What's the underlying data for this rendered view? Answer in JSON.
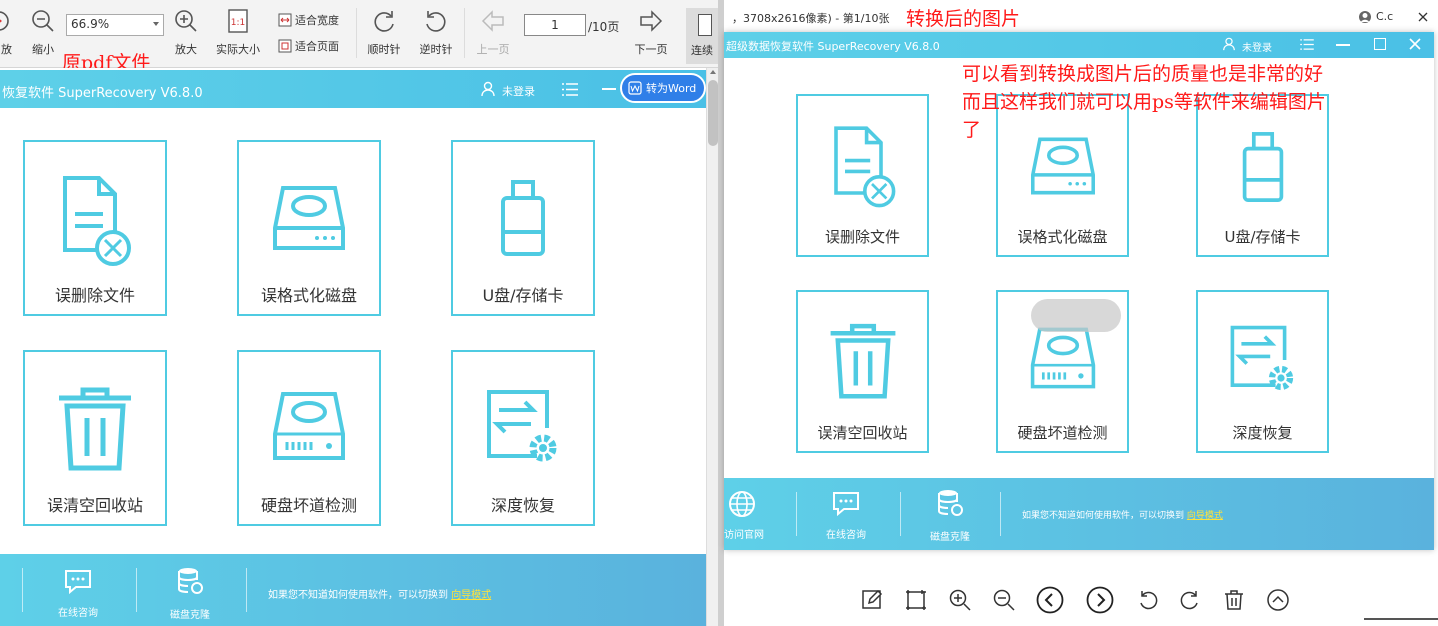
{
  "left_toolbar": {
    "zoom_value": "66.9%",
    "page_input": "1",
    "page_total": "/10页",
    "buttons": {
      "enlarge_partial": "放",
      "shrink": "缩小",
      "zoom_in": "放大",
      "actual_size": "实际大小",
      "fit_width": "适合宽度",
      "fit_page": "适合页面",
      "rotate_cw": "顺时针",
      "rotate_ccw": "逆时针",
      "prev_page": "上一页",
      "next_page": "下一页",
      "continuous_partial": "连续"
    }
  },
  "annotations": {
    "original_pdf": "原pdf文件",
    "converted": "转换后的图片",
    "note_lines": [
      "可以看到转换成图片后的质量也是非常的好",
      "而且这样我们就可以用ps等软件来编辑图片",
      "了"
    ]
  },
  "app": {
    "title_left": "恢复软件 SuperRecovery V6.8.0",
    "title_right": "超级数据恢复软件 SuperRecovery V6.8.0",
    "login": "未登录",
    "convert_word": "转为Word",
    "cards": [
      "误删除文件",
      "误格式化磁盘",
      "U盘/存储卡",
      "误清空回收站",
      "硬盘坏道检测",
      "深度恢复"
    ],
    "footer": {
      "visit_site_partial": "访问官网",
      "online_consult": "在线咨询",
      "disk_clone": "磁盘克隆",
      "guide_text": "如果您不知道如何使用软件，可以切换到",
      "guide_link": "向导模式"
    }
  },
  "right_viewer": {
    "info": "，3708x2616像素) - 第1/10张",
    "user": "C.c"
  },
  "colors": {
    "accent": "#4fcbe2",
    "header": "#4ac0e6",
    "annotation": "#ff1a1a",
    "link": "#ffe23a"
  }
}
